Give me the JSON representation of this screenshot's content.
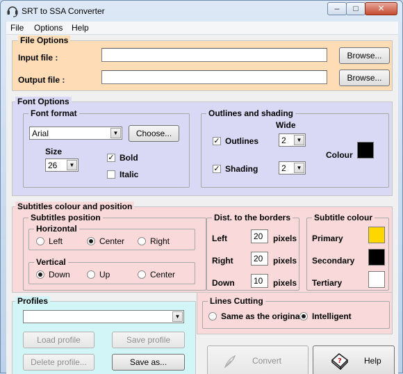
{
  "window": {
    "title": "SRT to SSA Converter",
    "controls": {
      "minimize": "–",
      "maximize": "□",
      "close": "✕"
    }
  },
  "menu": [
    "File",
    "Options",
    "Help"
  ],
  "file_options": {
    "legend": "File Options",
    "input_label": "Input file :",
    "input_value": "",
    "output_label": "Output file :",
    "output_value": "",
    "browse_label": "Browse..."
  },
  "font_options": {
    "legend": "Font Options",
    "font_format": {
      "legend": "Font format",
      "font": "Arial",
      "choose_label": "Choose...",
      "size_label": "Size",
      "size": "26",
      "bold_label": "Bold",
      "bold_checked": true,
      "italic_label": "Italic",
      "italic_checked": false
    },
    "outlines": {
      "legend": "Outlines and shading",
      "wide_label": "Wide",
      "outlines_label": "Outlines",
      "outlines_checked": true,
      "outlines_wide": "2",
      "shading_label": "Shading",
      "shading_checked": true,
      "shading_wide": "2",
      "colour_label": "Colour",
      "colour": "#000000"
    }
  },
  "subtitles": {
    "legend": "Subtitles colour and position",
    "position": {
      "legend": "Subtitles position",
      "horizontal": {
        "legend": "Horizontal",
        "options": [
          "Left",
          "Center",
          "Right"
        ],
        "selected": "Center"
      },
      "vertical": {
        "legend": "Vertical",
        "options": [
          "Down",
          "Up",
          "Center"
        ],
        "selected": "Down"
      }
    },
    "borders": {
      "legend": "Dist. to the borders",
      "unit": "pixels",
      "rows": [
        {
          "label": "Left",
          "value": "20"
        },
        {
          "label": "Right",
          "value": "20"
        },
        {
          "label": "Down",
          "value": "10"
        }
      ]
    },
    "colour": {
      "legend": "Subtitle colour",
      "rows": [
        {
          "label": "Primary",
          "color": "#ffd700"
        },
        {
          "label": "Secondary",
          "color": "#000000"
        },
        {
          "label": "Tertiary",
          "color": "#ffffff"
        }
      ]
    }
  },
  "profiles": {
    "legend": "Profiles",
    "selected": "",
    "load_label": "Load profile",
    "save_label": "Save profile",
    "delete_label": "Delete profile...",
    "save_as_label": "Save as..."
  },
  "lines_cutting": {
    "legend": "Lines Cutting",
    "options": [
      "Same as the origina",
      "Intelligent"
    ],
    "selected": "Intelligent"
  },
  "actions": {
    "convert_label": "Convert",
    "help_label": "Help"
  },
  "colors": {
    "file_panel": "#fddcb6",
    "font_panel": "#d9d9f5",
    "subtitle_panel": "#f9d9d9",
    "profile_panel": "#d2f5f7"
  }
}
